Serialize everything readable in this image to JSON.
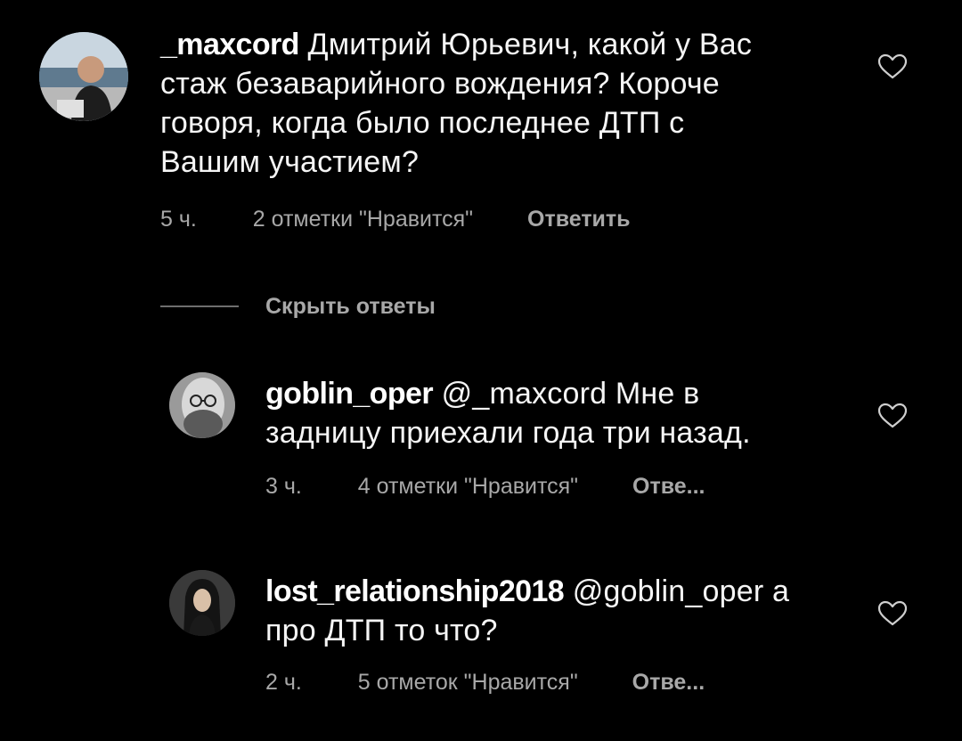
{
  "comments": [
    {
      "username": "_maxcord",
      "text": "Дмитрий Юрьевич, какой у Вас стаж безаварийного вождения? Короче говоря, когда было последнее ДТП с Вашим участием?",
      "line1_rest": " Дмитрий Юрьевич, какой у Вас",
      "line2": "стаж безаварийного вождения? Короче",
      "line3": "говоря, когда было последнее ДТП с",
      "line4": "Вашим участием?",
      "time": "5 ч.",
      "likes": "2 отметки \"Нравится\"",
      "reply": "Ответить",
      "avatar_icon": "man-at-desk-avatar"
    }
  ],
  "hide_replies_label": "Скрыть ответы",
  "replies": [
    {
      "username": "goblin_oper",
      "mention": "@_maxcord",
      "line1_rest": " @_maxcord Мне в",
      "line2": "задницу приехали года три назад.",
      "time": "3 ч.",
      "likes": "4 отметки \"Нравится\"",
      "reply": "Отве...",
      "avatar_icon": "bearded-man-glasses-avatar"
    },
    {
      "username": "lost_relationship2018",
      "line1_rest": " @goblin_oper а",
      "line2": "про ДТП то что?",
      "time": "2 ч.",
      "likes": "5 отметок \"Нравится\"",
      "reply": "Отве...",
      "avatar_icon": "long-hair-person-avatar"
    }
  ],
  "colors": {
    "background": "#000000",
    "text": "#f5f5f5",
    "meta": "#a8a8a8",
    "heart": "#cfcfcf"
  },
  "icons": [
    "heart-outline-icon"
  ]
}
